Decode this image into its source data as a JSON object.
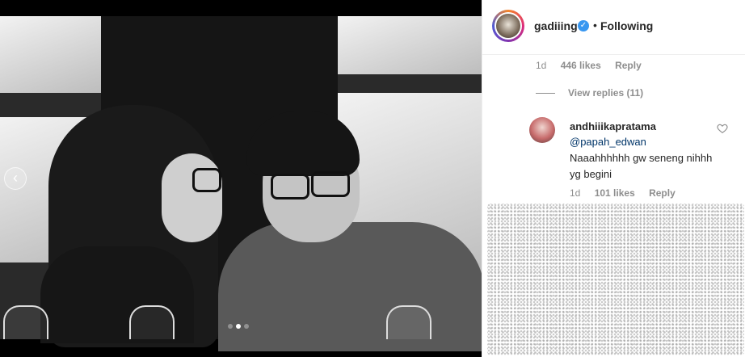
{
  "post": {
    "author": "gadiiing",
    "verified_mark": "✓",
    "separator": "•",
    "follow_status": "Following",
    "more_icon": "more-options-icon"
  },
  "media": {
    "carousel_dots": 3,
    "active_dot": 2,
    "prev_arrow": "‹"
  },
  "top_comment_meta": {
    "age": "1d",
    "likes": "446 likes",
    "reply": "Reply"
  },
  "replies": {
    "view_label": "View replies (11)"
  },
  "comment": {
    "username": "andhiiikapratama",
    "mention": "@papah_edwan",
    "text": "Naaahhhhhh gw seneng nihhh yg begini",
    "age": "1d",
    "likes": "101 likes",
    "reply": "Reply"
  },
  "colors": {
    "accent_blue": "#3897f0",
    "meta_gray": "#8e8e8e",
    "text": "#262626"
  }
}
